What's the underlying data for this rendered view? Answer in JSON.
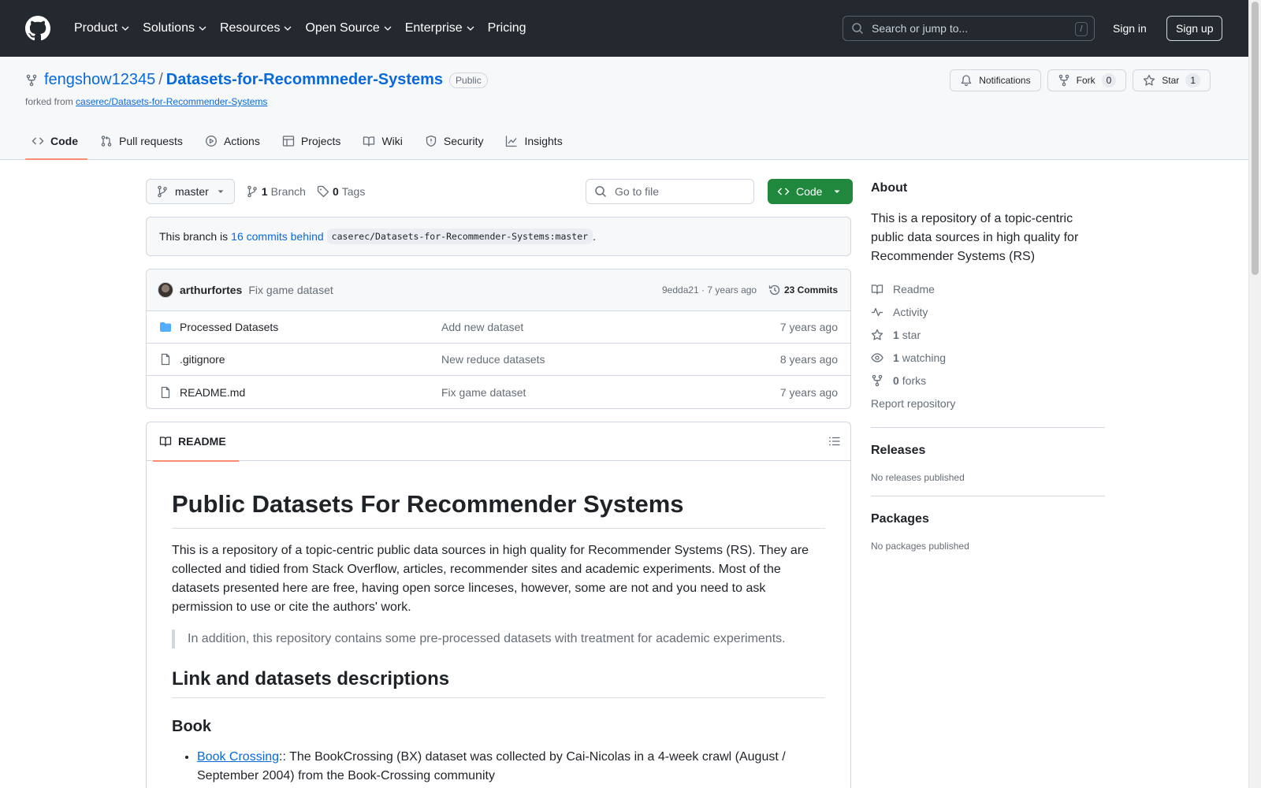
{
  "header": {
    "nav": [
      {
        "label": "Product",
        "has_menu": true
      },
      {
        "label": "Solutions",
        "has_menu": true
      },
      {
        "label": "Resources",
        "has_menu": true
      },
      {
        "label": "Open Source",
        "has_menu": true
      },
      {
        "label": "Enterprise",
        "has_menu": true
      },
      {
        "label": "Pricing",
        "has_menu": false
      }
    ],
    "search_placeholder": "Search or jump to...",
    "search_shortcut": "/",
    "sign_in": "Sign in",
    "sign_up": "Sign up"
  },
  "repo": {
    "owner": "fengshow12345",
    "separator": "/",
    "name": "Datasets-for-Recommneder-Systems",
    "visibility": "Public",
    "forked_from_label": "forked from",
    "forked_from": "caserec/Datasets-for-Recommender-Systems",
    "notifications_label": "Notifications",
    "fork_label": "Fork",
    "fork_count": "0",
    "star_label": "Star",
    "star_count": "1"
  },
  "tabs": [
    {
      "label": "Code",
      "icon": "code-icon",
      "active": true
    },
    {
      "label": "Pull requests",
      "icon": "pull-request-icon",
      "active": false
    },
    {
      "label": "Actions",
      "icon": "play-icon",
      "active": false
    },
    {
      "label": "Projects",
      "icon": "table-icon",
      "active": false
    },
    {
      "label": "Wiki",
      "icon": "book-icon",
      "active": false
    },
    {
      "label": "Security",
      "icon": "shield-icon",
      "active": false
    },
    {
      "label": "Insights",
      "icon": "graph-icon",
      "active": false
    }
  ],
  "toolbar": {
    "branch": "master",
    "branch_count": "1",
    "branch_label": "Branch",
    "tag_count": "0",
    "tag_label": "Tags",
    "goto_placeholder": "Go to file",
    "code_label": "Code"
  },
  "behind": {
    "prefix": "This branch is",
    "link": "16 commits behind",
    "ref": "caserec/Datasets-for-Recommender-Systems:master",
    "suffix": "."
  },
  "latest_commit": {
    "author": "arthurfortes",
    "message": "Fix game dataset",
    "meta": "9edda21 · 7 years ago",
    "commits": "23 Commits"
  },
  "files": [
    {
      "name": "Processed Datasets",
      "type": "directory",
      "message": "Add new dataset",
      "time": "7 years ago"
    },
    {
      "name": ".gitignore",
      "type": "file",
      "message": "New reduce datasets",
      "time": "8 years ago"
    },
    {
      "name": "README.md",
      "type": "file",
      "message": "Fix game dataset",
      "time": "7 years ago"
    }
  ],
  "readme": {
    "tab_label": "README",
    "title": "Public Datasets For Recommender Systems",
    "intro": "This is a repository of a topic-centric public data sources in high quality for Recommender Systems (RS). They are collected and tidied from Stack Overflow, articles, recommender sites and academic experiments. Most of the datasets presented here are free, having open sorce linceses, however, some are not and you need to ask permission to use or cite the authors' work.",
    "quote": "In addition, this repository contains some pre-processed datasets with treatment for academic experiments.",
    "h2": "Link and datasets descriptions",
    "h3": "Book",
    "item_link": "Book Crossing",
    "item_text": ":: The BookCrossing (BX) dataset was collected by Cai-Nicolas in a 4-week crawl (August / September 2004) from the Book-Crossing community"
  },
  "sidebar": {
    "about_title": "About",
    "description": "This is a repository of a topic-centric public data sources in high quality for Recommender Systems (RS)",
    "links": [
      {
        "label": "Readme",
        "count": "",
        "icon": "book-icon"
      },
      {
        "label": "Activity",
        "count": "",
        "icon": "pulse-icon"
      },
      {
        "label": "star",
        "count": "1",
        "icon": "star-icon"
      },
      {
        "label": "watching",
        "count": "1",
        "icon": "eye-icon"
      },
      {
        "label": "forks",
        "count": "0",
        "icon": "fork-icon"
      },
      {
        "label": "Report repository",
        "count": "",
        "icon": ""
      }
    ],
    "releases_title": "Releases",
    "releases_empty": "No releases published",
    "packages_title": "Packages",
    "packages_empty": "No packages published"
  },
  "colors": {
    "header_bg": "#24292f",
    "link": "#0969da",
    "primary_button": "#1f883d",
    "active_tab_underline": "#fd8c73",
    "folder": "#54aeff"
  }
}
